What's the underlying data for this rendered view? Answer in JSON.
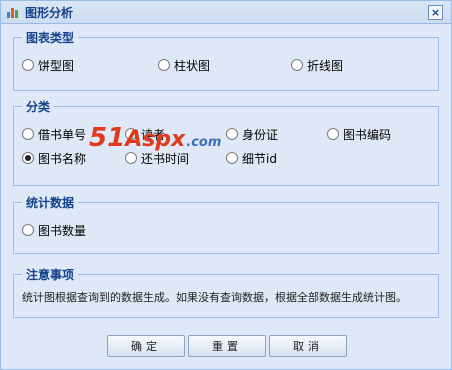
{
  "window": {
    "title": "图形分析",
    "close_glyph": "×",
    "title_icon": "bar-chart-icon",
    "accent_color": "#15428b",
    "border_color": "#99bbe8",
    "background_color": "#dfe8f6"
  },
  "chart_type": {
    "legend": "图表类型",
    "options": [
      {
        "label": "饼型图",
        "checked": false
      },
      {
        "label": "柱状图",
        "checked": false
      },
      {
        "label": "折线图",
        "checked": false
      }
    ]
  },
  "category": {
    "legend": "分类",
    "options": [
      {
        "label": "借书单号",
        "checked": false
      },
      {
        "label": "读者",
        "checked": false
      },
      {
        "label": "身份证",
        "checked": false
      },
      {
        "label": "图书编码",
        "checked": false
      },
      {
        "label": "图书名称",
        "checked": true
      },
      {
        "label": "还书时间",
        "checked": false
      },
      {
        "label": "细节id",
        "checked": false
      }
    ]
  },
  "statistics": {
    "legend": "统计数据",
    "options": [
      {
        "label": "图书数量",
        "checked": false
      }
    ]
  },
  "notes": {
    "legend": "注意事项",
    "text": "统计图根据查询到的数据生成。如果没有查询数据，根据全部数据生成统计图。"
  },
  "buttons": {
    "confirm": "确定",
    "reset": "重置",
    "cancel": "取消"
  },
  "watermark": {
    "part1": "51",
    "part2": "Aspx",
    "part3": ".com"
  }
}
